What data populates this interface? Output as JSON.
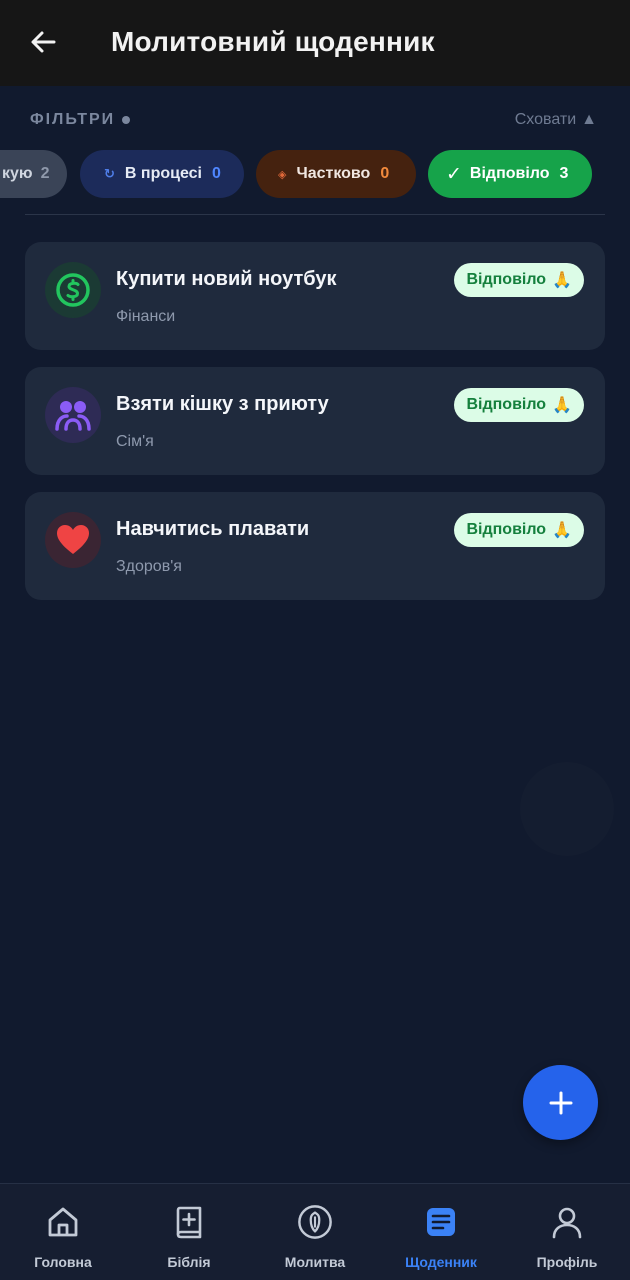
{
  "header": {
    "title": "Молитовний щоденник"
  },
  "filters": {
    "label": "ФІЛЬТРИ",
    "hide_label": "Сховати",
    "hide_arrow": "▲",
    "chips": {
      "all": {
        "label": "кую",
        "count": "2"
      },
      "progress": {
        "icon": "↻",
        "label": "В процесі",
        "count": "0"
      },
      "partial": {
        "icon": "◈",
        "label": "Частково",
        "count": "0"
      },
      "answered": {
        "icon": "✓",
        "label": "Відповіло",
        "count": "3"
      }
    }
  },
  "prayers": [
    {
      "title": "Купити новий ноутбук",
      "category": "Фінанси",
      "status": "Відповіло",
      "status_emoji": "🙏",
      "icon": "dollar-circle-icon",
      "icon_color": "#22c55e"
    },
    {
      "title": "Взяти кішку з приюту",
      "category": "Сім'я",
      "status": "Відповіло",
      "status_emoji": "🙏",
      "icon": "family-icon",
      "icon_color": "#8b5cf6"
    },
    {
      "title": "Навчитись плавати",
      "category": "Здоров'я",
      "status": "Відповіло",
      "status_emoji": "🙏",
      "icon": "heart-icon",
      "icon_color": "#ef4444"
    }
  ],
  "fab": {
    "icon": "plus-icon"
  },
  "nav": [
    {
      "label": "Головна",
      "icon": "home-icon"
    },
    {
      "label": "Біблія",
      "icon": "bible-icon"
    },
    {
      "label": "Молитва",
      "icon": "prayer-shield-icon"
    },
    {
      "label": "Щоденник",
      "icon": "journal-icon",
      "active": true
    },
    {
      "label": "Профіль",
      "icon": "profile-icon"
    }
  ],
  "colors": {
    "accent": "#2563eb",
    "answered": "#16a34a",
    "background": "#111a2e",
    "card": "#1f2a3d"
  }
}
